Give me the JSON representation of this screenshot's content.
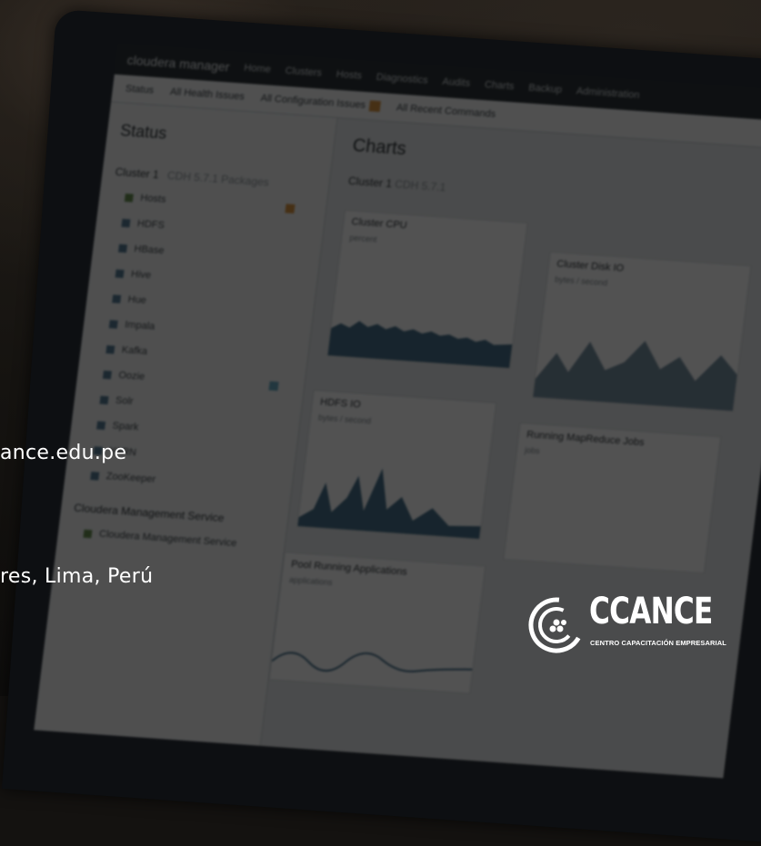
{
  "overlay": {
    "website_fragment": "ance.edu.pe",
    "address_fragment": "res, Lima, Perú"
  },
  "logo": {
    "wordmark": "CCANCE",
    "tagline": "CENTRO CAPACITACIÓN EMPRESARIAL"
  },
  "screen": {
    "navbar": {
      "brand": "cloudera manager",
      "items": [
        "Home",
        "Clusters",
        "Hosts",
        "Diagnostics",
        "Audits",
        "Charts",
        "Backup",
        "Administration"
      ]
    },
    "subbar": {
      "items": [
        "Status",
        "All Health Issues",
        "All Configuration Issues",
        "All Recent Commands"
      ]
    },
    "status": {
      "title": "Status",
      "cluster": "Cluster 1",
      "cluster_meta": "CDH 5.7.1 Packages",
      "services": [
        "Hosts",
        "HDFS",
        "HBase",
        "Hive",
        "Hue",
        "Impala",
        "Kafka",
        "Oozie",
        "Solr",
        "Spark",
        "YARN",
        "ZooKeeper"
      ],
      "management": "Cloudera Management Service",
      "management_child": "Cloudera Management Service"
    },
    "charts": {
      "title": "Charts",
      "subtitle": "Cluster 1",
      "subtitle_meta": "CDH 5.7.1",
      "cards": [
        {
          "title": "Cluster CPU",
          "meta": "percent"
        },
        {
          "title": "Cluster Disk IO",
          "meta": "bytes / second"
        },
        {
          "title": "HDFS IO",
          "meta": "bytes / second"
        },
        {
          "title": "Running MapReduce Jobs",
          "meta": "jobs"
        },
        {
          "title": "Pool Running Applications",
          "meta": "applications"
        }
      ]
    }
  },
  "colors": {
    "accent_orange": "#e48f2a",
    "chart_blue": "#3d6f8f"
  }
}
